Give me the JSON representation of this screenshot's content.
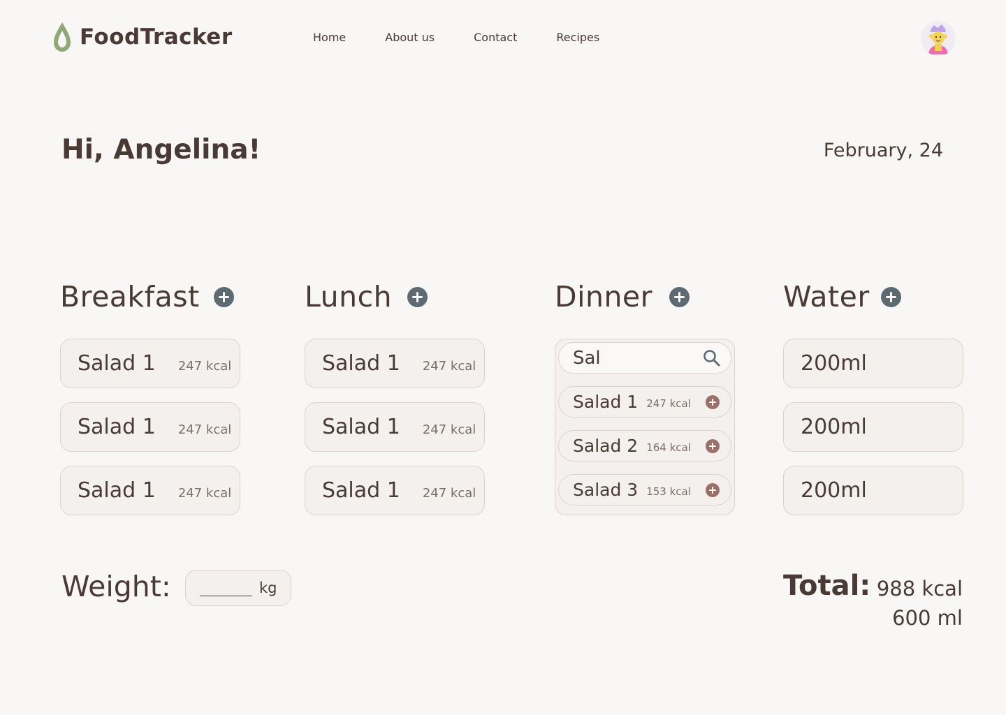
{
  "header": {
    "brand": "FoodTracker",
    "nav": [
      "Home",
      "About us",
      "Contact",
      "Recipes"
    ],
    "colors": {
      "logo_green": "#8fa875",
      "text": "#4a3a36"
    }
  },
  "greeting": "Hi, Angelina!",
  "date": "February, 24",
  "breakfast": {
    "title": "Breakfast",
    "items": [
      {
        "name": "Salad 1",
        "kcal": "247 kcal"
      },
      {
        "name": "Salad 1",
        "kcal": "247 kcal"
      },
      {
        "name": "Salad 1",
        "kcal": "247 kcal"
      }
    ]
  },
  "lunch": {
    "title": "Lunch",
    "items": [
      {
        "name": "Salad 1",
        "kcal": "247 kcal"
      },
      {
        "name": "Salad 1",
        "kcal": "247 kcal"
      },
      {
        "name": "Salad 1",
        "kcal": "247 kcal"
      }
    ]
  },
  "dinner": {
    "title": "Dinner",
    "search_value": "Sal",
    "results": [
      {
        "name": "Salad 1",
        "kcal": "247 kcal"
      },
      {
        "name": "Salad 2",
        "kcal": "164 kcal"
      },
      {
        "name": "Salad 3",
        "kcal": "153 kcal"
      }
    ]
  },
  "water": {
    "title": "Water",
    "items": [
      "200ml",
      "200ml",
      "200ml"
    ]
  },
  "weight": {
    "label": "Weight:",
    "unit": "kg"
  },
  "total": {
    "label": "Total:",
    "kcal": "988 kcal",
    "ml": "600 ml"
  },
  "icons": {
    "logo": "leaf-drop-icon",
    "add": "plus-circle-icon",
    "search": "magnifier-icon",
    "avatar": "user-avatar"
  }
}
